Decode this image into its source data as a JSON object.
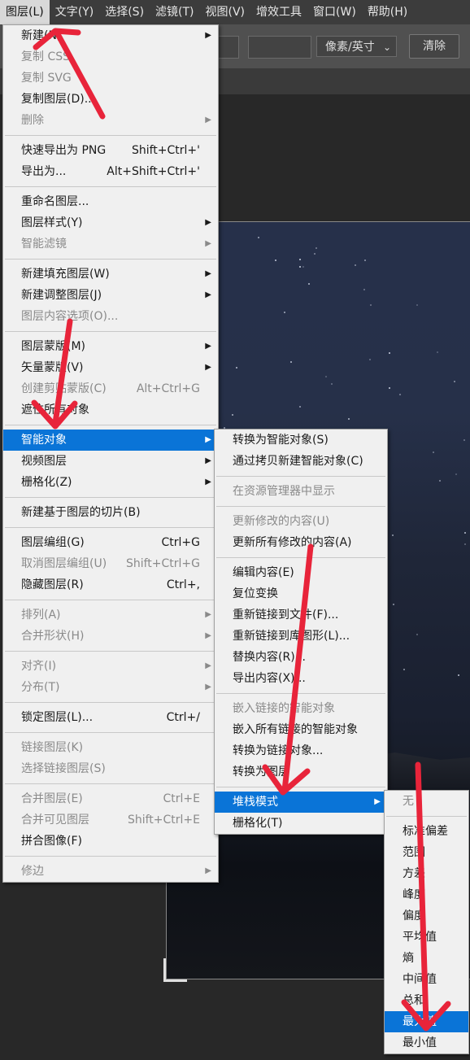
{
  "menubar": {
    "items": [
      {
        "label": "图层(L)"
      },
      {
        "label": "文字(Y)"
      },
      {
        "label": "选择(S)"
      },
      {
        "label": "滤镜(T)"
      },
      {
        "label": "视图(V)"
      },
      {
        "label": "增效工具"
      },
      {
        "label": "窗口(W)"
      },
      {
        "label": "帮助(H)"
      }
    ]
  },
  "options": {
    "unit_value": "像素/英寸",
    "unit_chevron": "⌄",
    "clear_label": "清除"
  },
  "layer_menu": {
    "groups": [
      [
        {
          "label": "新建(N)",
          "submenu": true
        },
        {
          "label": "复制 CSS",
          "disabled": true
        },
        {
          "label": "复制 SVG",
          "disabled": true
        },
        {
          "label": "复制图层(D)..."
        },
        {
          "label": "删除",
          "disabled": true,
          "submenu": true
        }
      ],
      [
        {
          "label": "快速导出为 PNG",
          "shortcut": "Shift+Ctrl+'"
        },
        {
          "label": "导出为...",
          "shortcut": "Alt+Shift+Ctrl+'"
        }
      ],
      [
        {
          "label": "重命名图层..."
        },
        {
          "label": "图层样式(Y)",
          "submenu": true
        },
        {
          "label": "智能滤镜",
          "disabled": true,
          "submenu": true
        }
      ],
      [
        {
          "label": "新建填充图层(W)",
          "submenu": true
        },
        {
          "label": "新建调整图层(J)",
          "submenu": true
        },
        {
          "label": "图层内容选项(O)...",
          "disabled": true
        }
      ],
      [
        {
          "label": "图层蒙版(M)",
          "submenu": true
        },
        {
          "label": "矢量蒙版(V)",
          "submenu": true
        },
        {
          "label": "创建剪贴蒙版(C)",
          "disabled": true,
          "shortcut": "Alt+Ctrl+G"
        },
        {
          "label": "遮住所有对象"
        }
      ],
      [
        {
          "label": "智能对象",
          "submenu": true,
          "highlighted": true
        },
        {
          "label": "视频图层",
          "submenu": true
        },
        {
          "label": "栅格化(Z)",
          "submenu": true
        }
      ],
      [
        {
          "label": "新建基于图层的切片(B)"
        }
      ],
      [
        {
          "label": "图层编组(G)",
          "shortcut": "Ctrl+G"
        },
        {
          "label": "取消图层编组(U)",
          "disabled": true,
          "shortcut": "Shift+Ctrl+G"
        },
        {
          "label": "隐藏图层(R)",
          "shortcut": "Ctrl+,"
        }
      ],
      [
        {
          "label": "排列(A)",
          "disabled": true,
          "submenu": true
        },
        {
          "label": "合并形状(H)",
          "disabled": true,
          "submenu": true
        }
      ],
      [
        {
          "label": "对齐(I)",
          "disabled": true,
          "submenu": true
        },
        {
          "label": "分布(T)",
          "disabled": true,
          "submenu": true
        }
      ],
      [
        {
          "label": "锁定图层(L)...",
          "shortcut": "Ctrl+/"
        }
      ],
      [
        {
          "label": "链接图层(K)",
          "disabled": true
        },
        {
          "label": "选择链接图层(S)",
          "disabled": true
        }
      ],
      [
        {
          "label": "合并图层(E)",
          "disabled": true,
          "shortcut": "Ctrl+E"
        },
        {
          "label": "合并可见图层",
          "disabled": true,
          "shortcut": "Shift+Ctrl+E"
        },
        {
          "label": "拼合图像(F)"
        }
      ],
      [
        {
          "label": "修边",
          "disabled": true,
          "submenu": true
        }
      ]
    ]
  },
  "smart_object_menu": {
    "groups": [
      [
        {
          "label": "转换为智能对象(S)"
        },
        {
          "label": "通过拷贝新建智能对象(C)"
        }
      ],
      [
        {
          "label": "在资源管理器中显示",
          "disabled": true
        }
      ],
      [
        {
          "label": "更新修改的内容(U)",
          "disabled": true
        },
        {
          "label": "更新所有修改的内容(A)"
        }
      ],
      [
        {
          "label": "编辑内容(E)"
        },
        {
          "label": "复位变换"
        },
        {
          "label": "重新链接到文件(F)..."
        },
        {
          "label": "重新链接到库图形(L)..."
        },
        {
          "label": "替换内容(R)..."
        },
        {
          "label": "导出内容(X)..."
        }
      ],
      [
        {
          "label": "嵌入链接的智能对象",
          "disabled": true
        },
        {
          "label": "嵌入所有链接的智能对象"
        },
        {
          "label": "转换为链接对象..."
        },
        {
          "label": "转换为图层"
        }
      ],
      [
        {
          "label": "堆栈模式",
          "submenu": true,
          "highlighted": true
        },
        {
          "label": "栅格化(T)"
        }
      ]
    ]
  },
  "stack_mode_menu": {
    "groups": [
      [
        {
          "label": "无",
          "disabled": true
        }
      ],
      [
        {
          "label": "标准偏差"
        },
        {
          "label": "范围"
        },
        {
          "label": "方差"
        },
        {
          "label": "峰度"
        },
        {
          "label": "偏度"
        },
        {
          "label": "平均值"
        },
        {
          "label": "熵"
        },
        {
          "label": "中间值"
        },
        {
          "label": "总和"
        },
        {
          "label": "最大值",
          "highlighted": true
        },
        {
          "label": "最小值"
        }
      ]
    ]
  },
  "icons": {
    "submenu_arrow": "▶"
  },
  "colors": {
    "highlight": "#0a74d7",
    "annotation": "#e8243a",
    "menu_bg": "#f0f0f0"
  }
}
